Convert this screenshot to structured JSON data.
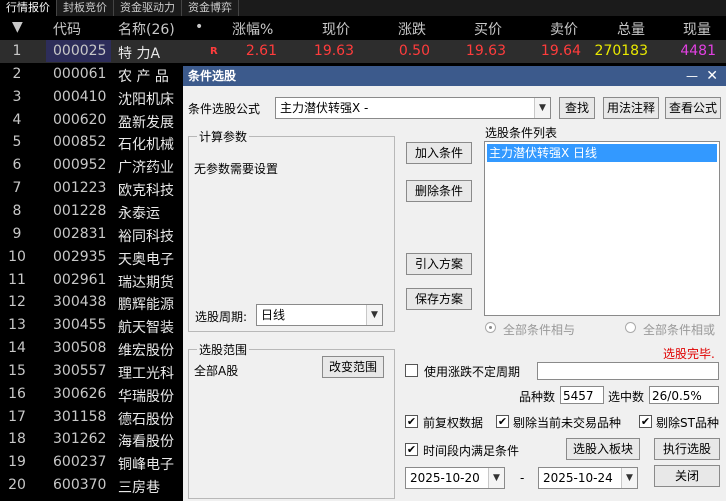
{
  "tabs": [
    "行情报价",
    "封板竞价",
    "资金驱动力",
    "资金博弈"
  ],
  "table": {
    "headers": {
      "idx": "▼",
      "code": "代码",
      "name": "名称(26)",
      "dot": "•",
      "pct": "涨幅%",
      "price": "现价",
      "change": "涨跌",
      "bid": "买价",
      "ask": "卖价",
      "vol": "总量",
      "cur": "现量"
    },
    "rows": [
      {
        "idx": "1",
        "code": "000025",
        "name": "特 力A",
        "flag": "R",
        "pct": "2.61",
        "price": "19.63",
        "change": "0.50",
        "bid": "19.63",
        "ask": "19.64",
        "vol": "270183",
        "cur": "4481"
      },
      {
        "idx": "2",
        "code": "000061",
        "name": "农 产 品"
      },
      {
        "idx": "3",
        "code": "000410",
        "name": "沈阳机床"
      },
      {
        "idx": "4",
        "code": "000620",
        "name": "盈新发展"
      },
      {
        "idx": "5",
        "code": "000852",
        "name": "石化机械"
      },
      {
        "idx": "6",
        "code": "000952",
        "name": "广济药业"
      },
      {
        "idx": "7",
        "code": "001223",
        "name": "欧克科技"
      },
      {
        "idx": "8",
        "code": "001228",
        "name": "永泰运"
      },
      {
        "idx": "9",
        "code": "002831",
        "name": "裕同科技"
      },
      {
        "idx": "10",
        "code": "002935",
        "name": "天奥电子"
      },
      {
        "idx": "11",
        "code": "002961",
        "name": "瑞达期货"
      },
      {
        "idx": "12",
        "code": "300438",
        "name": "鹏辉能源"
      },
      {
        "idx": "13",
        "code": "300455",
        "name": "航天智装"
      },
      {
        "idx": "14",
        "code": "300508",
        "name": "维宏股份"
      },
      {
        "idx": "15",
        "code": "300557",
        "name": "理工光科"
      },
      {
        "idx": "16",
        "code": "300626",
        "name": "华瑞股份"
      },
      {
        "idx": "17",
        "code": "301158",
        "name": "德石股份"
      },
      {
        "idx": "18",
        "code": "301262",
        "name": "海看股份"
      },
      {
        "idx": "19",
        "code": "600237",
        "name": "铜峰电子"
      },
      {
        "idx": "20",
        "code": "600370",
        "name": "三房巷"
      }
    ]
  },
  "dialog": {
    "title": "条件选股",
    "formula_label": "条件选股公式",
    "formula_value": "主力潜伏转强X  -",
    "btn_find": "查找",
    "btn_usage": "用法注释",
    "btn_view": "查看公式",
    "params_title": "计算参数",
    "params_text": "无参数需要设置",
    "period_label": "选股周期:",
    "period_value": "日线",
    "btn_add": "加入条件",
    "btn_delete": "删除条件",
    "btn_import": "引入方案",
    "btn_save": "保存方案",
    "list_title": "选股条件列表",
    "list_item": "主力潜伏转强X  日线",
    "radio_and": "全部条件相与",
    "radio_or": "全部条件相或",
    "status": "选股完毕.",
    "range_title": "选股范围",
    "range_value": "全部A股",
    "btn_range": "改变范围",
    "use_period_label": "使用涨跌不定周期",
    "count_label": "品种数",
    "count_value": "5457",
    "selected_label": "选中数",
    "selected_value": "26/0.5%",
    "chk_fq": "前复权数据",
    "chk_exclude_notrade": "剔除当前未交易品种",
    "chk_exclude_st": "剔除ST品种",
    "chk_timerange": "时间段内满足条件",
    "btn_to_block": "选股入板块",
    "btn_exec": "执行选股",
    "date_from": "2025-10-20",
    "date_sep": "-",
    "date_to": "2025-10-24",
    "btn_close": "关闭"
  },
  "colors": {
    "up": "#ff3c3c",
    "vol": "#e8e800",
    "cur": "#e040e0",
    "selbg": "#3c5a8c"
  }
}
